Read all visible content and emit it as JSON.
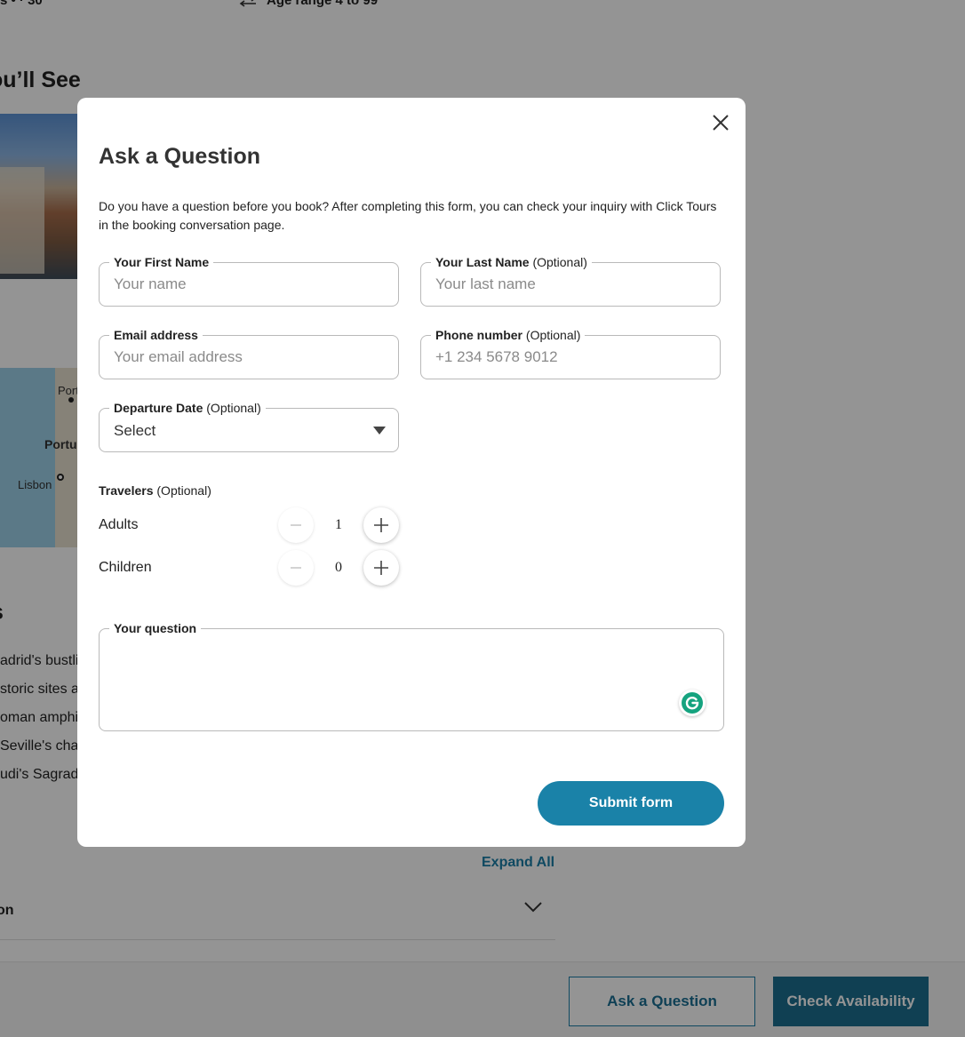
{
  "background": {
    "meta": {
      "left_fragment": "s • · 30",
      "age_range": "Age range 4 to 99"
    },
    "section_heading": "ou’ll See",
    "map_labels": {
      "porto": "Port",
      "portugal": "Portu",
      "lisbon": "Lisbon"
    },
    "itinerary_heading": "s",
    "itinerary_lines": [
      "adrid's bustli",
      "storic sites a",
      "oman amphit",
      "Seville's charr",
      "udi's Sagrad"
    ],
    "expand_all": "Expand All",
    "accordion_label": "on",
    "footer": {
      "ask_label": "Ask a Question",
      "check_label": "Check Availability"
    }
  },
  "modal": {
    "title": "Ask a Question",
    "description": "Do you have a question before you book? After completing this form, you can check your inquiry with Click Tours in the booking conversation page.",
    "first_name": {
      "label": "Your First Name",
      "placeholder": "Your name"
    },
    "last_name": {
      "label": "Your Last Name",
      "optional": "(Optional)",
      "placeholder": "Your last name"
    },
    "email": {
      "label": "Email address",
      "placeholder": "Your email address"
    },
    "phone": {
      "label": "Phone number",
      "optional": "(Optional)",
      "placeholder": "+1 234 5678 9012"
    },
    "departure": {
      "label": "Departure Date",
      "optional": "(Optional)",
      "value": "Select"
    },
    "travelers": {
      "label": "Travelers",
      "optional": "(Optional)",
      "adults": {
        "label": "Adults",
        "value": "1"
      },
      "children": {
        "label": "Children",
        "value": "0"
      }
    },
    "question": {
      "label": "Your question"
    },
    "submit_label": "Submit form"
  },
  "colors": {
    "accent": "#1a82a8",
    "overlay": "rgba(0,0,0,0.42)",
    "grammarly": "#15c39a"
  }
}
